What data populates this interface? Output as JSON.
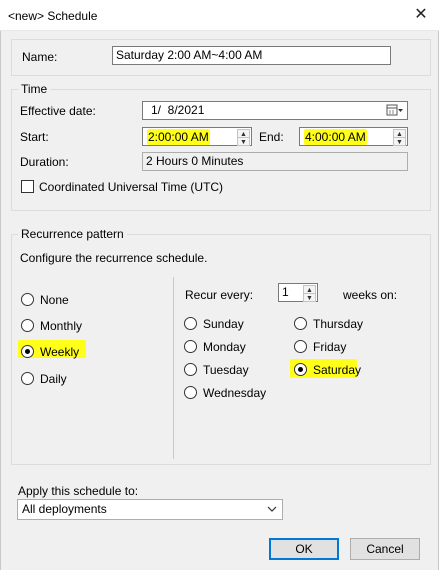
{
  "window": {
    "title": "<new> Schedule",
    "close_glyph": "✕"
  },
  "name_field": {
    "label": "Name:",
    "value": "Saturday 2:00 AM~4:00 AM"
  },
  "time_group": {
    "legend": "Time",
    "effective_date_label": "Effective date:",
    "effective_date_value": "1/  8/2021",
    "start_label": "Start:",
    "start_value": "2:00:00 AM",
    "end_label": "End:",
    "end_value": "4:00:00 AM",
    "duration_label": "Duration:",
    "duration_value": "2 Hours 0 Minutes",
    "utc_label": "Coordinated Universal Time (UTC)",
    "utc_checked": false
  },
  "recurrence_group": {
    "legend": "Recurrence pattern",
    "description": "Configure the recurrence schedule.",
    "patterns": [
      {
        "label": "None",
        "checked": false
      },
      {
        "label": "Monthly",
        "checked": false
      },
      {
        "label": "Weekly",
        "checked": true
      },
      {
        "label": "Daily",
        "checked": false
      }
    ],
    "recur_every_label": "Recur every:",
    "recur_every_value": "1",
    "weeks_on_label": "weeks on:",
    "days": [
      {
        "label": "Sunday",
        "checked": false
      },
      {
        "label": "Monday",
        "checked": false
      },
      {
        "label": "Tuesday",
        "checked": false
      },
      {
        "label": "Wednesday",
        "checked": false
      },
      {
        "label": "Thursday",
        "checked": false
      },
      {
        "label": "Friday",
        "checked": false
      },
      {
        "label": "Saturday",
        "checked": true
      }
    ]
  },
  "apply_to": {
    "label": "Apply this schedule to:",
    "selected": "All deployments"
  },
  "buttons": {
    "ok": "OK",
    "cancel": "Cancel"
  },
  "colors": {
    "highlight": "#ffff1a",
    "focus_border": "#0078d7",
    "dialog_bg": "#f0f0f0"
  }
}
